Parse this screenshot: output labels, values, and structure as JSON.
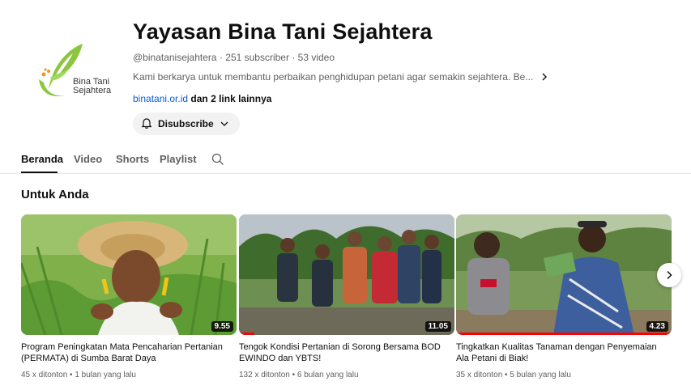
{
  "channel": {
    "title": "Yayasan Bina Tani Sejahtera",
    "handle": "@binatanisejahtera",
    "subscribers": "251 subscriber",
    "videos": "53 video",
    "meta_sep": " · ",
    "description": "Kami berkarya untuk membantu perbaikan penghidupan petani agar semakin sejahtera. Be...",
    "link": "binatani.or.id",
    "more_links": "dan 2 link lainnya",
    "subscribe_label": "Disubscribe",
    "logo_text_line1": "Bina Tani",
    "logo_text_line2": "Sejahtera"
  },
  "tabs": [
    {
      "label": "Beranda",
      "active": true
    },
    {
      "label": "Video",
      "active": false
    },
    {
      "label": "Shorts",
      "active": false
    },
    {
      "label": "Playlist",
      "active": false
    }
  ],
  "section": {
    "title": "Untuk Anda"
  },
  "videos": [
    {
      "title": "Program Peningkatan Mata Pencaharian Pertanian (PERMATA) di Sumba Barat Daya",
      "duration": "9.55",
      "views": "45 x ditonton",
      "age": "1 bulan yang lalu",
      "watched_fraction": 0
    },
    {
      "title": "Tengok Kondisi Pertanian di Sorong Bersama BOD EWINDO dan YBTS!",
      "duration": "11.05",
      "views": "132 x ditonton",
      "age": "6 bulan yang lalu",
      "watched_fraction": 0.07
    },
    {
      "title": "Tingkatkan Kualitas Tanaman dengan Penyemaian Ala Petani di Biak!",
      "duration": "4.23",
      "views": "35 x ditonton",
      "age": "5 bulan yang lalu",
      "watched_fraction": 1
    }
  ],
  "meta_dot": " • ",
  "colors": {
    "link": "#065fd4",
    "progress": "#ff0000",
    "logo_green": "#8cc63f",
    "logo_orange": "#f7941d"
  },
  "icons": {
    "bell": "bell-icon",
    "chevron_down": "chevron-down-icon",
    "chevron_right": "chevron-right-icon",
    "search": "search-icon",
    "next": "next-arrow-icon"
  }
}
